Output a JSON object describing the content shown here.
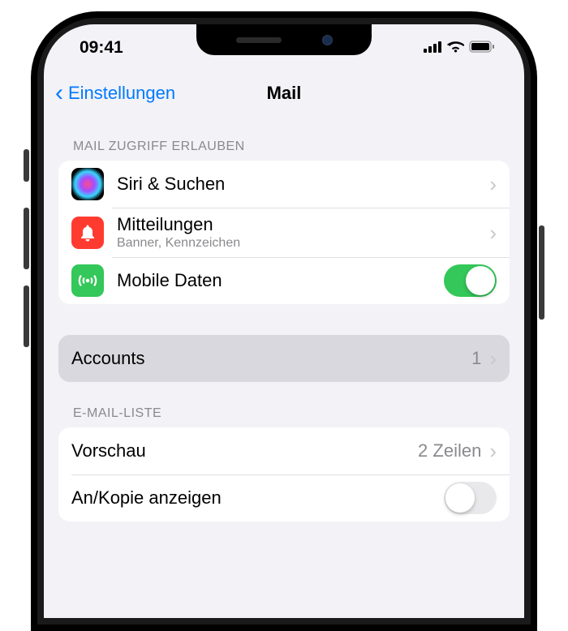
{
  "status": {
    "time": "09:41"
  },
  "nav": {
    "back": "Einstellungen",
    "title": "Mail"
  },
  "section1": {
    "header": "MAIL ZUGRIFF ERLAUBEN"
  },
  "rows": {
    "siri": {
      "label": "Siri & Suchen"
    },
    "notifications": {
      "label": "Mitteilungen",
      "sublabel": "Banner, Kennzeichen"
    },
    "cellular": {
      "label": "Mobile Daten"
    }
  },
  "accounts": {
    "label": "Accounts",
    "value": "1"
  },
  "section2": {
    "header": "E-MAIL-LISTE"
  },
  "preview": {
    "label": "Vorschau",
    "value": "2 Zeilen"
  },
  "showcc": {
    "label": "An/Kopie anzeigen"
  }
}
